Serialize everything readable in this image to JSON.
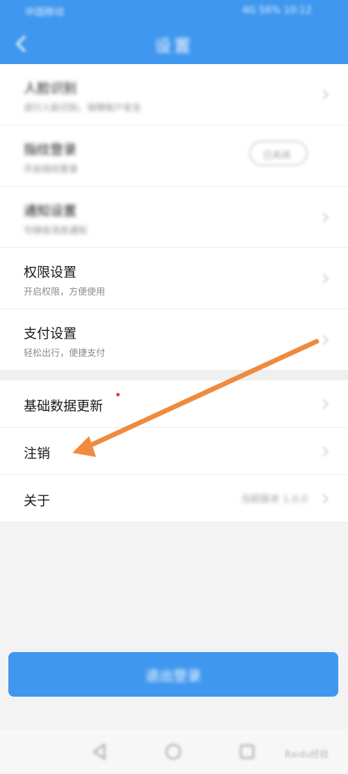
{
  "status_bar": {
    "left_text": "中国移动",
    "right_text": "4G 56% 10:12"
  },
  "header": {
    "title": "设置",
    "back_icon": "chevron-left-icon"
  },
  "settings": {
    "blurred_items": [
      {
        "label": "人脸识别",
        "sub": "进行人脸识别，保障账户安全"
      },
      {
        "label": "指纹登录",
        "sub": "开启指纹登录",
        "toggle_label": "已关闭"
      },
      {
        "label": "通知设置",
        "sub": "可接收消息通知"
      }
    ],
    "permission": {
      "label": "权限设置",
      "sub": "开启权限，方便使用"
    },
    "payment": {
      "label": "支付设置",
      "sub": "轻松出行，便捷支付"
    },
    "data_update": {
      "label": "基础数据更新"
    },
    "logout": {
      "label": "注销"
    },
    "about": {
      "label": "关于",
      "version": "当前版本 1.0.0"
    }
  },
  "logout_button": {
    "label": "退出登录"
  },
  "bottom_nav": {
    "back_icon": "triangle-back-icon",
    "home_icon": "circle-home-icon",
    "recent_icon": "square-recent-icon"
  },
  "watermark": "Baidu经验",
  "colors": {
    "primary": "#3f97ef",
    "arrow": "#f08a3e",
    "badge": "#e53935"
  }
}
